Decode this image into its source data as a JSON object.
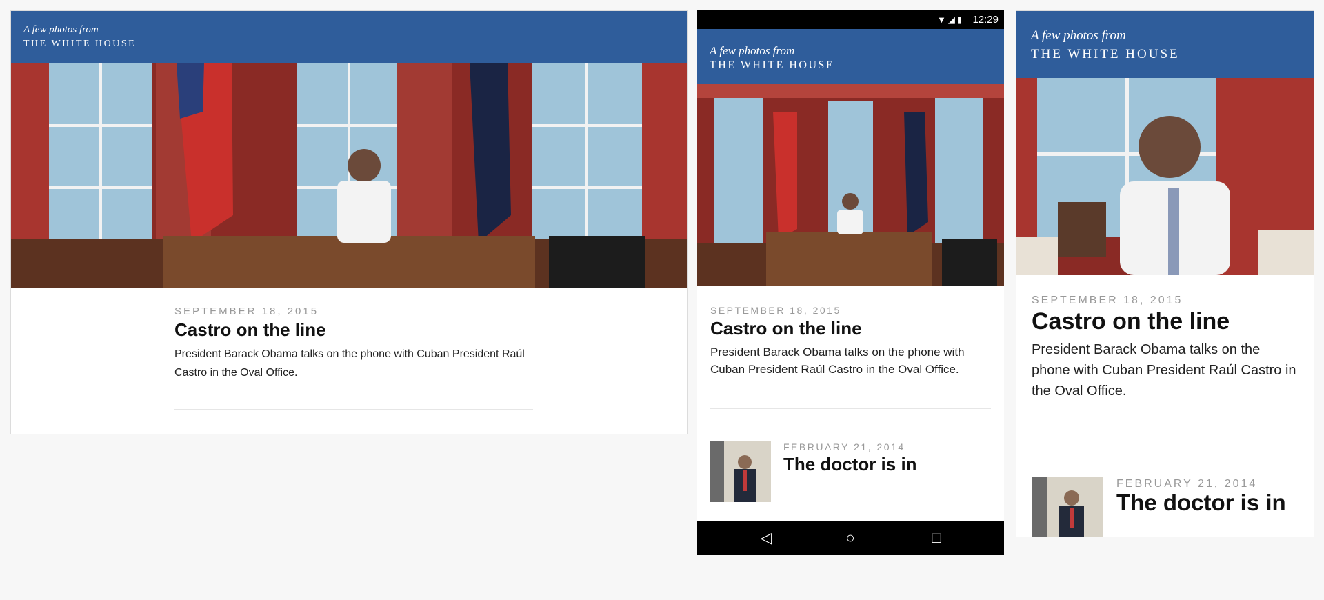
{
  "site": {
    "tagline": "A few photos from",
    "name": "THE WHITE HOUSE"
  },
  "status_bar": {
    "time": "12:29",
    "icons": [
      "wifi-icon",
      "signal-icon",
      "battery-icon"
    ]
  },
  "featured": {
    "date": "SEPTEMBER 18, 2015",
    "title": "Castro on the line",
    "caption": "President Barack Obama talks on the phone with Cuban President Raúl Castro in the Oval Office."
  },
  "next": {
    "date": "FEBRUARY 21, 2014",
    "title": "The doctor is in"
  },
  "nav_bar": {
    "back": "◁",
    "home": "○",
    "recents": "□"
  },
  "colors": {
    "header_blue": "#2f5d9b",
    "date_gray": "#999999"
  }
}
